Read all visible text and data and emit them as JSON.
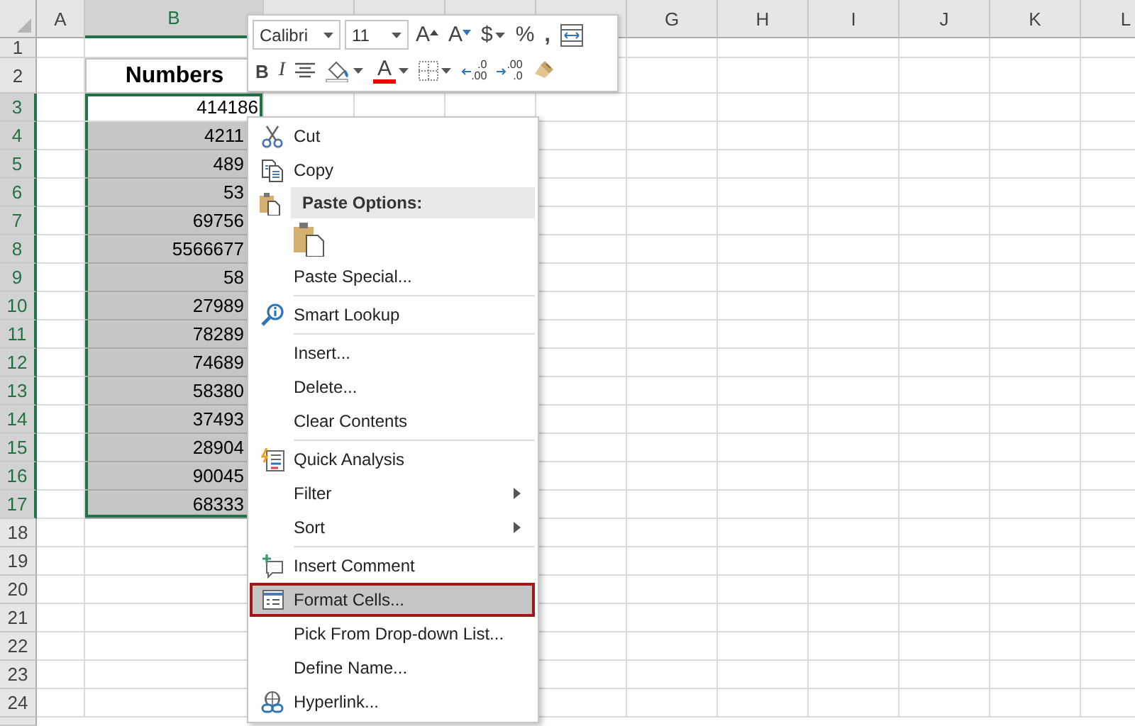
{
  "sheet": {
    "columns": [
      {
        "label": "A",
        "selected": false
      },
      {
        "label": "B",
        "selected": true
      },
      {
        "label": "G",
        "selected": false
      },
      {
        "label": "H",
        "selected": false
      },
      {
        "label": "I",
        "selected": false
      },
      {
        "label": "J",
        "selected": false
      },
      {
        "label": "K",
        "selected": false
      },
      {
        "label": "L",
        "selected": false
      }
    ],
    "rows": [
      {
        "header": "1",
        "selected": false
      },
      {
        "header": "2",
        "selected": false,
        "value": "Numbers",
        "kind": "heading"
      },
      {
        "header": "3",
        "selected": true,
        "active": true,
        "value": "414186"
      },
      {
        "header": "4",
        "selected": true,
        "active": false,
        "value": "4211"
      },
      {
        "header": "5",
        "selected": true,
        "active": false,
        "value": "489"
      },
      {
        "header": "6",
        "selected": true,
        "active": false,
        "value": "53"
      },
      {
        "header": "7",
        "selected": true,
        "active": false,
        "value": "69756"
      },
      {
        "header": "8",
        "selected": true,
        "active": false,
        "value": "5566677"
      },
      {
        "header": "9",
        "selected": true,
        "active": false,
        "value": "58"
      },
      {
        "header": "10",
        "selected": true,
        "active": false,
        "value": "27989"
      },
      {
        "header": "11",
        "selected": true,
        "active": false,
        "value": "78289"
      },
      {
        "header": "12",
        "selected": true,
        "active": false,
        "value": "74689"
      },
      {
        "header": "13",
        "selected": true,
        "active": false,
        "value": "58380"
      },
      {
        "header": "14",
        "selected": true,
        "active": false,
        "value": "37493"
      },
      {
        "header": "15",
        "selected": true,
        "active": false,
        "value": "28904"
      },
      {
        "header": "16",
        "selected": true,
        "active": false,
        "value": "90045"
      },
      {
        "header": "17",
        "selected": true,
        "active": false,
        "value": "68333"
      },
      {
        "header": "18",
        "selected": false
      },
      {
        "header": "19",
        "selected": false
      },
      {
        "header": "20",
        "selected": false
      },
      {
        "header": "21",
        "selected": false
      },
      {
        "header": "22",
        "selected": false
      },
      {
        "header": "23",
        "selected": false
      },
      {
        "header": "24",
        "selected": false
      }
    ]
  },
  "mini_toolbar": {
    "font": "Calibri",
    "size": "11",
    "row1": [
      {
        "kind": "grow",
        "label": "A",
        "dropdown": false
      },
      {
        "kind": "shrink",
        "label": "A",
        "dropdown": false
      },
      {
        "kind": "currency",
        "label": "$",
        "dropdown": true
      },
      {
        "kind": "percent",
        "label": "%",
        "dropdown": false
      },
      {
        "kind": "comma",
        "label": ",",
        "dropdown": false
      },
      {
        "kind": "wrap",
        "dropdown": false
      }
    ],
    "row2": [
      {
        "kind": "bold",
        "label": "B",
        "dropdown": false
      },
      {
        "kind": "italic",
        "label": "I",
        "dropdown": false
      },
      {
        "kind": "center",
        "dropdown": false
      },
      {
        "kind": "fill",
        "dropdown": true
      },
      {
        "kind": "font-color",
        "label": "A",
        "dropdown": true
      },
      {
        "kind": "borders",
        "dropdown": true
      },
      {
        "kind": "increase-decimal",
        "top": ".0",
        "bottom": ".00",
        "dropdown": false
      },
      {
        "kind": "decrease-decimal",
        "top": ".00",
        "bottom": ".0",
        "dropdown": false
      },
      {
        "kind": "painter",
        "dropdown": false
      }
    ]
  },
  "context_menu": [
    {
      "kind": "item",
      "label": "Cut",
      "submenu": false,
      "selected": false
    },
    {
      "kind": "item",
      "label": "Copy",
      "submenu": false,
      "selected": false
    },
    {
      "kind": "header",
      "label": "Paste Options:"
    },
    {
      "kind": "paste-icons"
    },
    {
      "kind": "item",
      "label": "Paste Special...",
      "submenu": false,
      "selected": false
    },
    {
      "kind": "separator"
    },
    {
      "kind": "item",
      "label": "Smart Lookup",
      "submenu": false,
      "selected": false
    },
    {
      "kind": "separator"
    },
    {
      "kind": "item",
      "label": "Insert...",
      "submenu": false,
      "selected": false
    },
    {
      "kind": "item",
      "label": "Delete...",
      "submenu": false,
      "selected": false
    },
    {
      "kind": "item",
      "label": "Clear Contents",
      "submenu": false,
      "selected": false
    },
    {
      "kind": "separator"
    },
    {
      "kind": "item",
      "label": "Quick Analysis",
      "submenu": false,
      "selected": false
    },
    {
      "kind": "item",
      "label": "Filter",
      "submenu": true,
      "selected": false
    },
    {
      "kind": "item",
      "label": "Sort",
      "submenu": true,
      "selected": false
    },
    {
      "kind": "separator"
    },
    {
      "kind": "item",
      "label": "Insert Comment",
      "submenu": false,
      "selected": false
    },
    {
      "kind": "item",
      "label": "Format Cells...",
      "submenu": false,
      "selected": true
    },
    {
      "kind": "item",
      "label": "Pick From Drop-down List...",
      "submenu": false,
      "selected": false
    },
    {
      "kind": "item",
      "label": "Define Name...",
      "submenu": false,
      "selected": false
    },
    {
      "kind": "item",
      "label": "Hyperlink...",
      "submenu": false,
      "selected": false
    }
  ]
}
